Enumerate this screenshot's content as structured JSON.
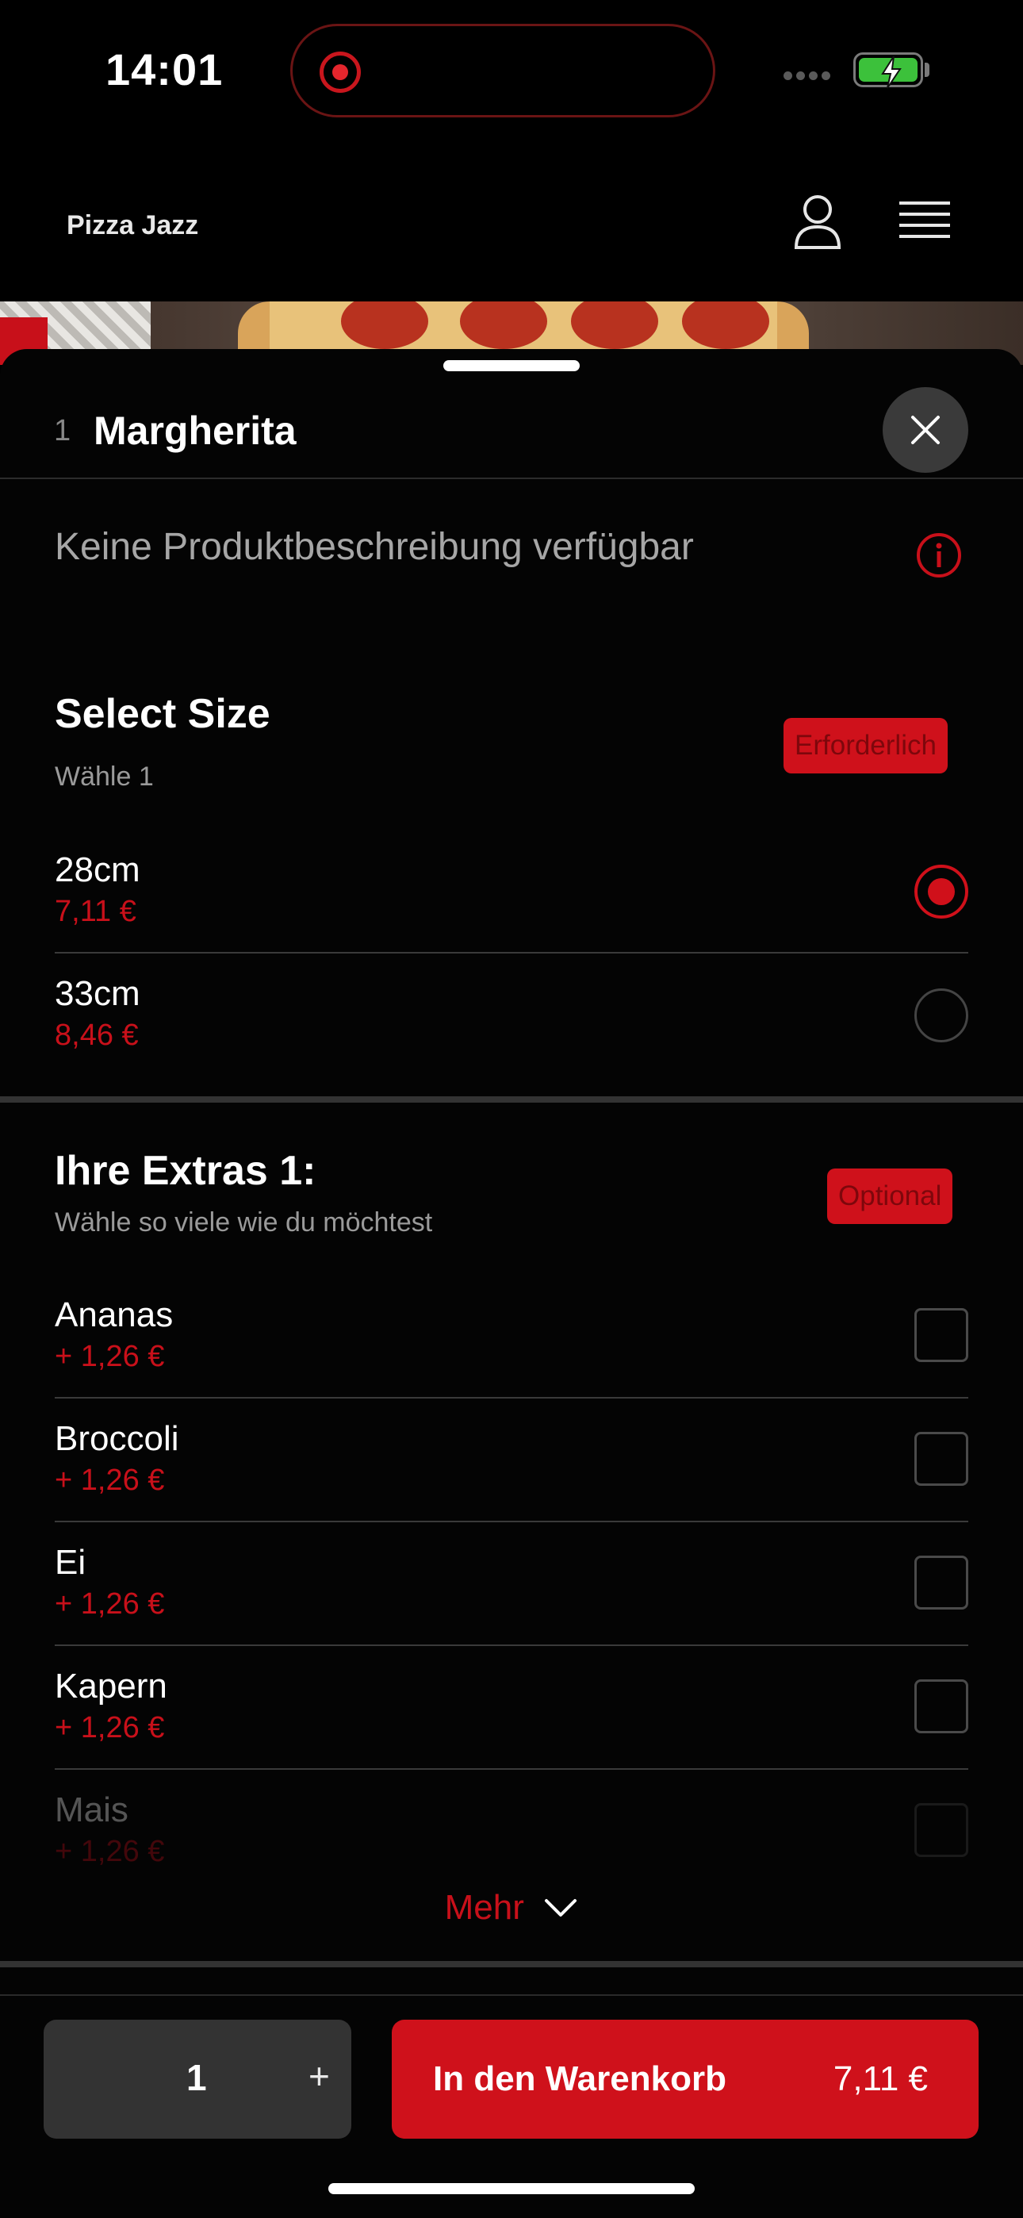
{
  "status_bar": {
    "time": "14:01"
  },
  "header": {
    "brand": "Pizza Jazz"
  },
  "product": {
    "quantity_prefix": "1",
    "name": "Margherita",
    "description": "Keine Produktbeschreibung verfügbar"
  },
  "size_section": {
    "title": "Select Size",
    "subtitle": "Wähle 1",
    "badge": "Erforderlich",
    "options": [
      {
        "name": "28cm",
        "price": "7,11 €",
        "selected": true
      },
      {
        "name": "33cm",
        "price": "8,46 €",
        "selected": false
      }
    ]
  },
  "extras_section": {
    "title": "Ihre Extras 1:",
    "subtitle": "Wähle so viele wie du möchtest",
    "badge": "Optional",
    "options": [
      {
        "name": "Ananas",
        "price": "+ 1,26 €"
      },
      {
        "name": "Broccoli",
        "price": "+ 1,26 €"
      },
      {
        "name": "Ei",
        "price": "+ 1,26 €"
      },
      {
        "name": "Kapern",
        "price": "+ 1,26 €"
      },
      {
        "name": "Mais",
        "price": "+ 1,26 €"
      }
    ],
    "more_label": "Mehr"
  },
  "bottom_bar": {
    "quantity": "1",
    "plus_label": "+",
    "cart_label": "In den Warenkorb",
    "cart_price": "7,11 €"
  },
  "colors": {
    "accent": "#cf111b",
    "background": "#000000",
    "battery": "#3cc13b"
  }
}
